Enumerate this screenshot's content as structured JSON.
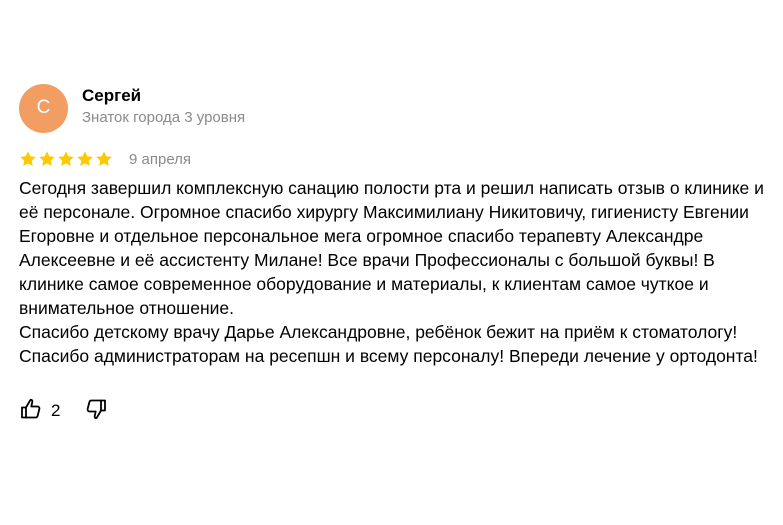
{
  "review": {
    "author": {
      "initial": "С",
      "name": "Сергей",
      "level": "Знаток города 3 уровня",
      "avatar_color": "#f29d61"
    },
    "rating": 5,
    "star_color": "#fcca00",
    "date": "9 апреля",
    "text": {
      "paragraph1": "Сегодня завершил комплексную санацию полости рта и решил написать отзыв о клинике и её персонале. Огромное спасибо хирургу Максимилиану Никитовичу, гигиенисту Евгении Егоровне и отдельное персональное мега огромное спасибо терапевту Александре Алексеевне и её ассистенту Милане! Все врачи Профессионалы с большой буквы! В клинике самое современное оборудование и материалы, к клиентам самое чуткое и внимательное отношение.",
      "paragraph2": "Спасибо детскому врачу Дарье Александровне, ребёнок бежит на приём к стоматологу! Спасибо администраторам на ресепшн и всему персоналу! Впереди лечение у ортодонта!"
    },
    "actions": {
      "like_icon": "thumbs-up-icon",
      "like_count": "2",
      "dislike_icon": "thumbs-down-icon"
    }
  }
}
